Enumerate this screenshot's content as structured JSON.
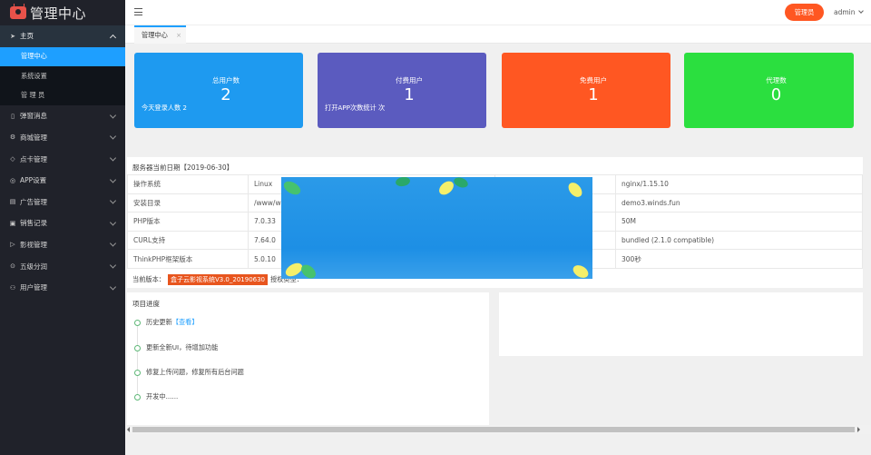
{
  "app": {
    "title": "管理中心"
  },
  "sidebar": {
    "main": {
      "label": "主页"
    },
    "sub_items": [
      {
        "label": "管理中心",
        "active": true
      },
      {
        "label": "系统设置"
      },
      {
        "label": "管 理 员"
      }
    ],
    "items": [
      {
        "label": "弹窗消息",
        "icon": "phone-icon"
      },
      {
        "label": "商城管理",
        "icon": "gear-icon"
      },
      {
        "label": "点卡管理",
        "icon": "diamond-icon"
      },
      {
        "label": "APP设置",
        "icon": "compass-icon"
      },
      {
        "label": "广告管理",
        "icon": "document-icon"
      },
      {
        "label": "销售记录",
        "icon": "cart-icon"
      },
      {
        "label": "影视管理",
        "icon": "play-icon"
      },
      {
        "label": "五级分润",
        "icon": "share-icon"
      },
      {
        "label": "用户管理",
        "icon": "user-icon"
      }
    ]
  },
  "header": {
    "role_button": "管理员",
    "username": "admin"
  },
  "tabs": [
    {
      "label": "管理中心",
      "close": "×"
    }
  ],
  "cards": [
    {
      "title": "总用户数",
      "value": "2",
      "sub": "今天登录人数 2",
      "color": "#1e9af0"
    },
    {
      "title": "付费用户",
      "value": "1",
      "sub": "打开APP次数统计 次",
      "color": "#5b5bbf"
    },
    {
      "title": "免费用户",
      "value": "1",
      "sub": "",
      "color": "#ff5722"
    },
    {
      "title": "代理数",
      "value": "0",
      "sub": "",
      "color": "#2bdf3f"
    }
  ],
  "server": {
    "title": "服务器当前日期【2019-06-30】",
    "rows": [
      {
        "k1": "操作系统",
        "v1": "Linux",
        "v2": "nginx/1.15.10"
      },
      {
        "k1": "安装目录",
        "v1": "/www/w",
        "v2": "demo3.winds.fun"
      },
      {
        "k1": "PHP版本",
        "v1": "7.0.33",
        "v2": "50M"
      },
      {
        "k1": "CURL支持",
        "v1": "7.64.0",
        "v2": "bundled (2.1.0 compatible)"
      },
      {
        "k1": "ThinkPHP框架版本",
        "v1": "5.0.10",
        "v2": "300秒"
      }
    ],
    "version_label": "当前版本：",
    "version_badge": "盒子云影视系统V3.0_20190630",
    "auth_label": "授权类型："
  },
  "progress": {
    "title": "项目进度",
    "items": [
      {
        "text": "历史更新",
        "link": "【查看】"
      },
      {
        "text": "更新全新UI，待增加功能"
      },
      {
        "text": "修复上传问题，修复所有后台问题"
      },
      {
        "text": "开发中......"
      }
    ]
  }
}
